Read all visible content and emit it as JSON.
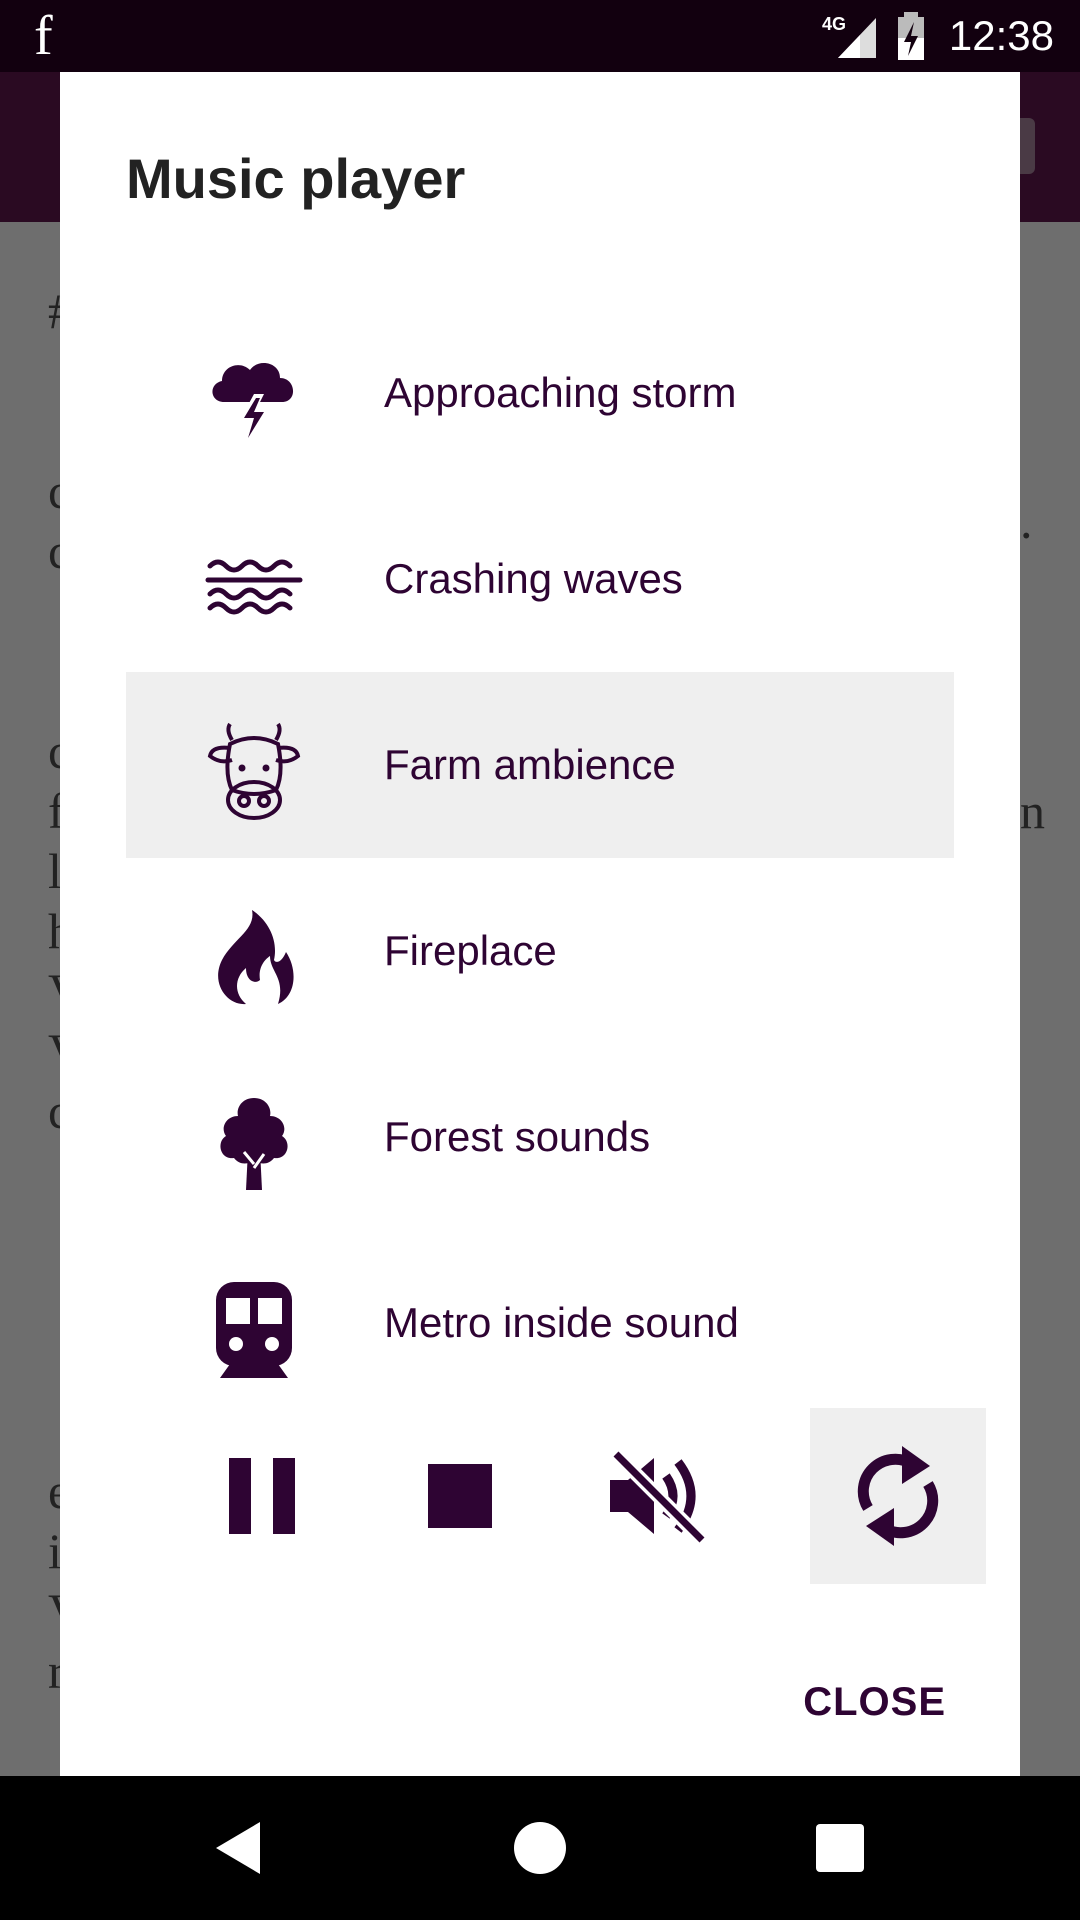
{
  "status_bar": {
    "app_glyph": "f",
    "network": "4G",
    "time": "12:38"
  },
  "dialog": {
    "title": "Music player",
    "items": [
      {
        "label": "Approaching storm",
        "icon": "storm-cloud-icon",
        "selected": false
      },
      {
        "label": "Crashing waves",
        "icon": "waves-icon",
        "selected": false
      },
      {
        "label": "Farm ambience",
        "icon": "cow-icon",
        "selected": true
      },
      {
        "label": "Fireplace",
        "icon": "fire-icon",
        "selected": false
      },
      {
        "label": "Forest sounds",
        "icon": "tree-icon",
        "selected": false
      },
      {
        "label": "Metro inside sound",
        "icon": "metro-train-icon",
        "selected": false
      }
    ],
    "controls": [
      {
        "name": "pause",
        "icon": "pause-icon"
      },
      {
        "name": "stop",
        "icon": "stop-icon"
      },
      {
        "name": "mute",
        "icon": "volume-mute-icon"
      },
      {
        "name": "repeat",
        "icon": "repeat-icon",
        "active": true
      }
    ],
    "close_label": "CLOSE"
  },
  "colors": {
    "accent": "#2e0433",
    "selected_bg": "#efefef",
    "status_bar_bg": "#12000f"
  }
}
